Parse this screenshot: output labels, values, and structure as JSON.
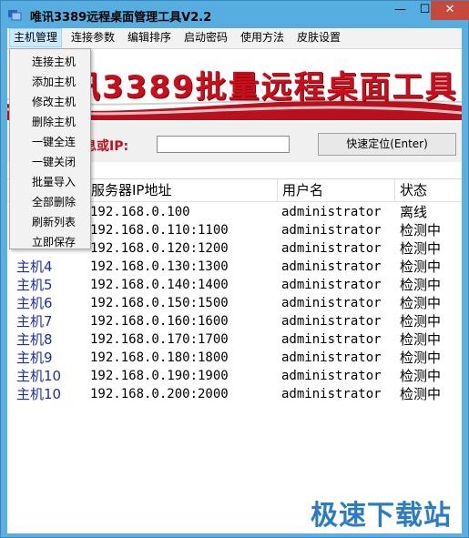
{
  "window": {
    "title": "唯讯3389远程桌面管理工具V2.2",
    "controls": {
      "minimize": "—",
      "maximize": "☐",
      "close": "✕"
    }
  },
  "menu": [
    {
      "label": "主机管理"
    },
    {
      "label": "连接参数"
    },
    {
      "label": "编辑排序"
    },
    {
      "label": "启动密码"
    },
    {
      "label": "使用方法"
    },
    {
      "label": "皮肤设置"
    }
  ],
  "dropdown": [
    "连接主机",
    "添加主机",
    "修改主机",
    "删除主机",
    "一键全连",
    "一键关闭",
    "批量导入",
    "全部删除",
    "刷新列表",
    "立即保存"
  ],
  "banner": {
    "text": "讯3389批量远程桌面工具"
  },
  "search": {
    "label": "息或IP:",
    "value": "",
    "button": "快速定位(Enter)"
  },
  "table": {
    "headers": [
      "",
      "服务器IP地址",
      "用户名",
      "状态"
    ],
    "rows": [
      {
        "name": "",
        "ip": "192.168.0.100",
        "user": "administrator",
        "status": "离线"
      },
      {
        "name": "",
        "ip": "192.168.0.110:1100",
        "user": "administrator",
        "status": "检测中"
      },
      {
        "name": "",
        "ip": "192.168.0.120:1200",
        "user": "administrator",
        "status": "检测中"
      },
      {
        "name": "主机4",
        "ip": "192.168.0.130:1300",
        "user": "administrator",
        "status": "检测中"
      },
      {
        "name": "主机5",
        "ip": "192.168.0.140:1400",
        "user": "administrator",
        "status": "检测中"
      },
      {
        "name": "主机6",
        "ip": "192.168.0.150:1500",
        "user": "administrator",
        "status": "检测中"
      },
      {
        "name": "主机7",
        "ip": "192.168.0.160:1600",
        "user": "administrator",
        "status": "检测中"
      },
      {
        "name": "主机8",
        "ip": "192.168.0.170:1700",
        "user": "administrator",
        "status": "检测中"
      },
      {
        "name": "主机9",
        "ip": "192.168.0.180:1800",
        "user": "administrator",
        "status": "检测中"
      },
      {
        "name": "主机10",
        "ip": "192.168.0.190:1900",
        "user": "administrator",
        "status": "检测中"
      },
      {
        "name": "主机10",
        "ip": "192.168.0.200:2000",
        "user": "administrator",
        "status": "检测中"
      }
    ]
  },
  "watermark": "极速下载站",
  "colors": {
    "title_bar": "#56aee0",
    "accent_red": "#c80f1d",
    "host_name_blue": "#1c2ea0",
    "close_button": "#c7493b"
  }
}
